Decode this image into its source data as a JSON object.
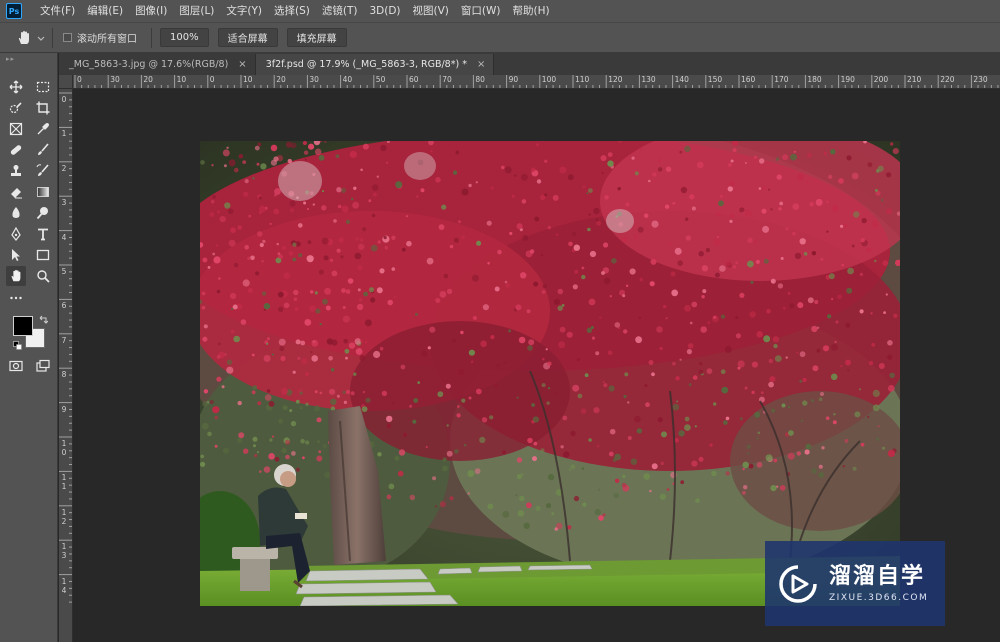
{
  "menubar": {
    "logo": "Ps",
    "items": [
      "文件(F)",
      "编辑(E)",
      "图像(I)",
      "图层(L)",
      "文字(Y)",
      "选择(S)",
      "滤镜(T)",
      "3D(D)",
      "视图(V)",
      "窗口(W)",
      "帮助(H)"
    ]
  },
  "options": {
    "scroll_all_label": "滚动所有窗口",
    "zoom_btn": "100%",
    "fit_screen_btn": "适合屏幕",
    "fill_screen_btn": "填充屏幕"
  },
  "tabs": [
    {
      "label": "_MG_5863-3.jpg @ 17.6%(RGB/8)",
      "close": "×",
      "active": false
    },
    {
      "label": "3f2f.psd @ 17.9% (_MG_5863-3, RGB/8*) *",
      "close": "×",
      "active": true
    }
  ],
  "ruler_top": [
    "0",
    "30",
    "20",
    "10",
    "0",
    "10",
    "20",
    "30",
    "40",
    "50",
    "60",
    "70",
    "80",
    "90",
    "100",
    "110",
    "120",
    "130",
    "140",
    "150",
    "160",
    "170",
    "180",
    "190",
    "200",
    "210",
    "220",
    "230"
  ],
  "ruler_left": [
    "0",
    "1",
    "2",
    "3",
    "4",
    "5",
    "6",
    "7",
    "8",
    "9",
    "1 0",
    "1 1",
    "1 2",
    "1 3",
    "1 4"
  ],
  "colors": {
    "foreground": "#000000",
    "background": "#f0f0f0",
    "ui_panel": "#535353",
    "workspace": "#282828"
  },
  "watermark": {
    "title": "溜溜自学",
    "subtitle": "ZIXUE.3D66.COM"
  }
}
